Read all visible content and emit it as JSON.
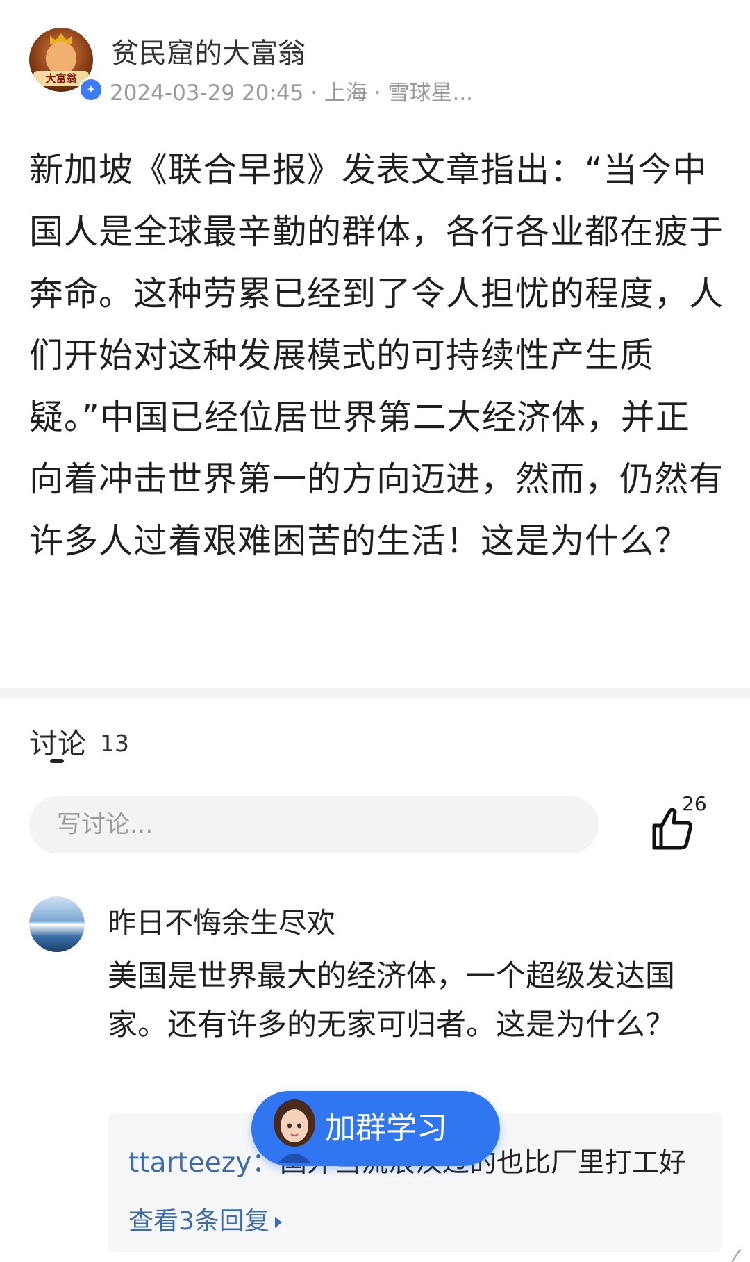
{
  "post": {
    "author": "贫民窟的大富翁",
    "avatar_badge_text": "大富翁",
    "meta": "2024-03-29 20:45 · 上海 · 雪球星...",
    "body": "新加坡《联合早报》发表文章指出：“当今中国人是全球最辛勤的群体，各行各业都在疲于奔命。这种劳累已经到了令人担忧的程度，人们开始对这种发展模式的可持续性产生质疑。”中国已经位居世界第二大经济体，并正向着冲击世界第一的方向迈进，然而，仍然有许多人过着艰难困苦的生活！这是为什么？"
  },
  "discussion": {
    "tab_label": "讨论",
    "count": "13",
    "input_placeholder": "写讨论...",
    "like_count": "26"
  },
  "comments": [
    {
      "author": "昨日不悔余生尽欢",
      "text": "美国是世界最大的经济体，一个超级发达国家。还有许多的无家可归者。这是为什么？",
      "reply": {
        "author": "ttarteezy",
        "separator": "：",
        "text": "国外当流浪汉过的也比厂里打工好",
        "view_more": "查看3条回复"
      }
    }
  ],
  "floating_button": {
    "label": "加群学习"
  },
  "colors": {
    "accent": "#2f76f0",
    "link": "#3d6aa8",
    "meta": "#9a9a9a"
  },
  "icons": [
    "verified-icon",
    "thumbs-up-icon",
    "triangle-right-icon"
  ]
}
